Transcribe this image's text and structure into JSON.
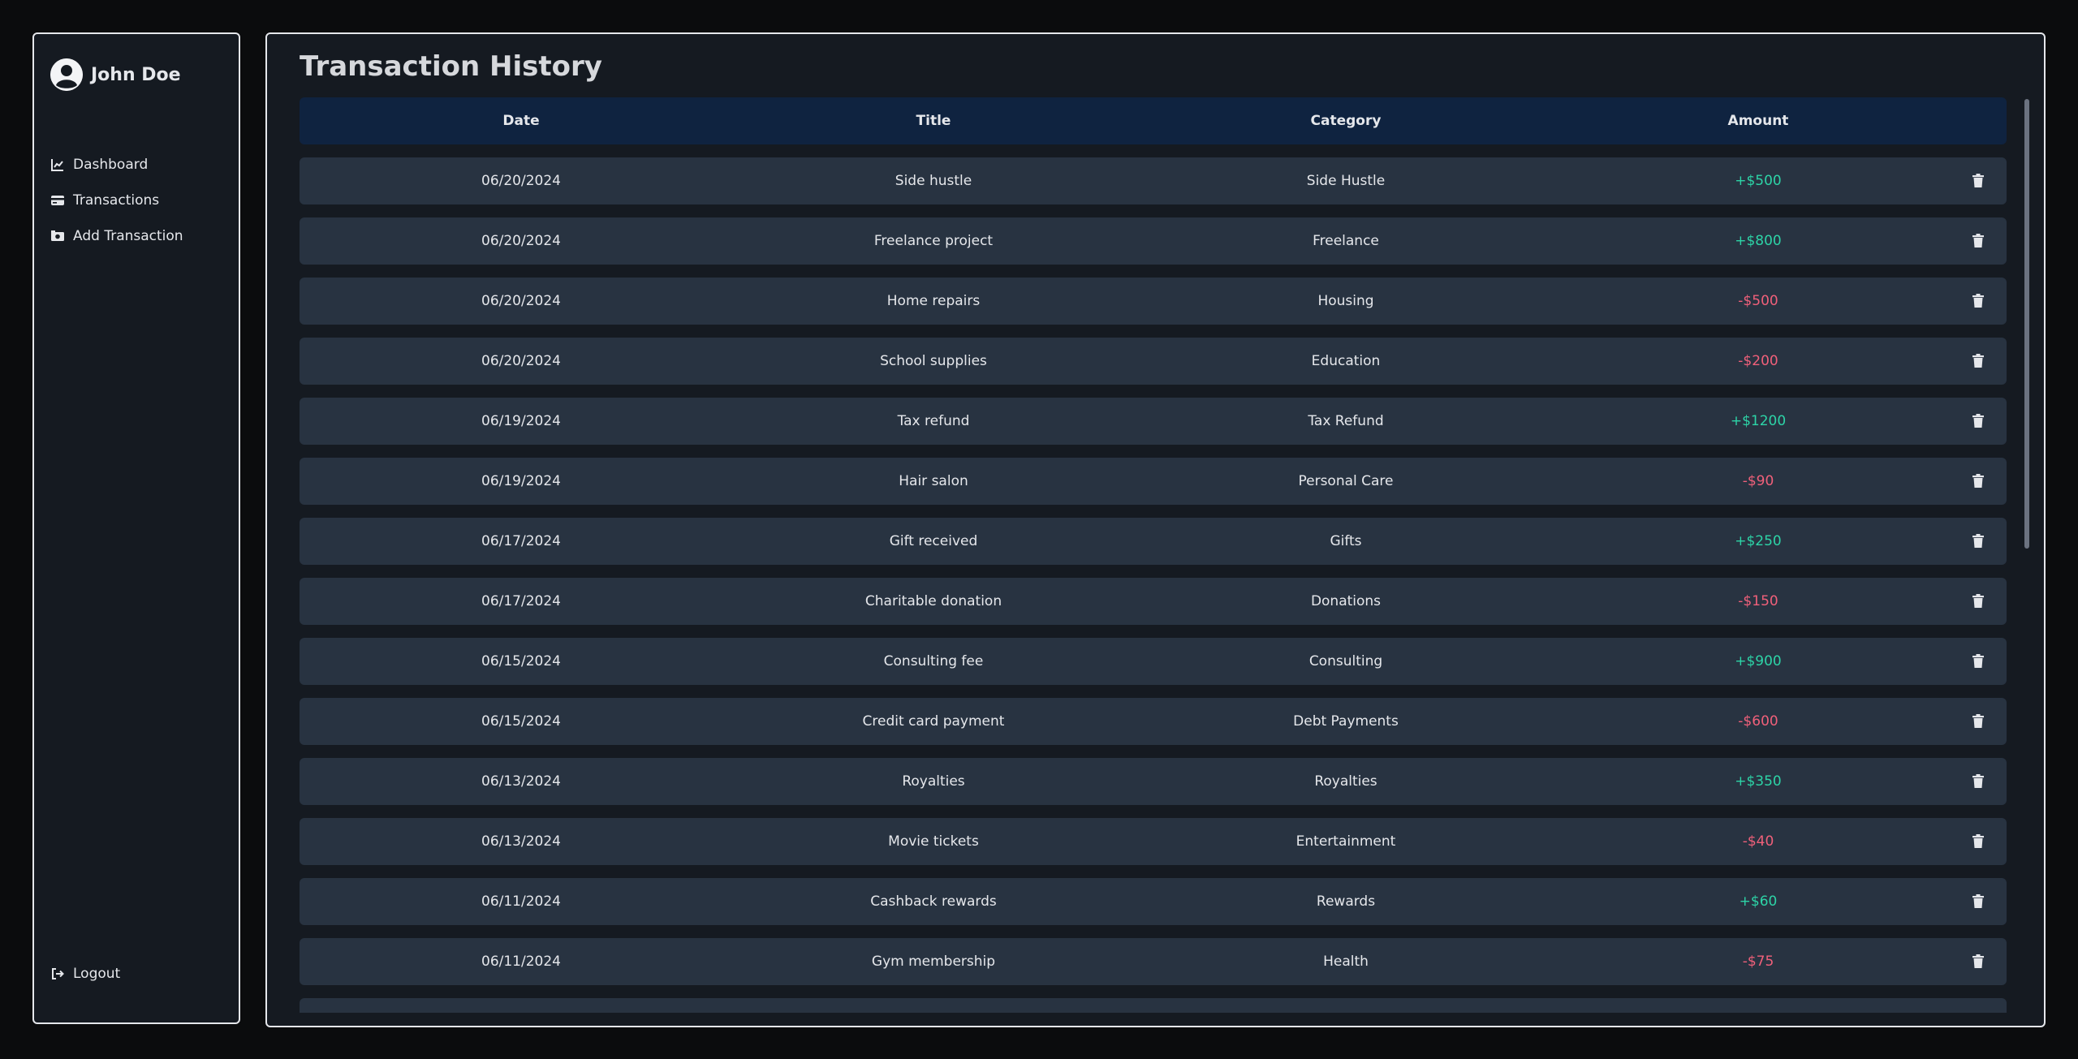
{
  "user": {
    "name": "John Doe"
  },
  "nav": {
    "items": [
      {
        "label": "Dashboard",
        "icon": "chart-line-icon"
      },
      {
        "label": "Transactions",
        "icon": "credit-card-icon"
      },
      {
        "label": "Add Transaction",
        "icon": "money-bill-icon"
      }
    ],
    "logout_label": "Logout"
  },
  "main": {
    "title": "Transaction History",
    "columns": [
      "Date",
      "Title",
      "Category",
      "Amount"
    ],
    "transactions": [
      {
        "date": "06/20/2024",
        "title": "Side hustle",
        "category": "Side Hustle",
        "amount": "+$500",
        "type": "income"
      },
      {
        "date": "06/20/2024",
        "title": "Freelance project",
        "category": "Freelance",
        "amount": "+$800",
        "type": "income"
      },
      {
        "date": "06/20/2024",
        "title": "Home repairs",
        "category": "Housing",
        "amount": "-$500",
        "type": "expense"
      },
      {
        "date": "06/20/2024",
        "title": "School supplies",
        "category": "Education",
        "amount": "-$200",
        "type": "expense"
      },
      {
        "date": "06/19/2024",
        "title": "Tax refund",
        "category": "Tax Refund",
        "amount": "+$1200",
        "type": "income"
      },
      {
        "date": "06/19/2024",
        "title": "Hair salon",
        "category": "Personal Care",
        "amount": "-$90",
        "type": "expense"
      },
      {
        "date": "06/17/2024",
        "title": "Gift received",
        "category": "Gifts",
        "amount": "+$250",
        "type": "income"
      },
      {
        "date": "06/17/2024",
        "title": "Charitable donation",
        "category": "Donations",
        "amount": "-$150",
        "type": "expense"
      },
      {
        "date": "06/15/2024",
        "title": "Consulting fee",
        "category": "Consulting",
        "amount": "+$900",
        "type": "income"
      },
      {
        "date": "06/15/2024",
        "title": "Credit card payment",
        "category": "Debt Payments",
        "amount": "-$600",
        "type": "expense"
      },
      {
        "date": "06/13/2024",
        "title": "Royalties",
        "category": "Royalties",
        "amount": "+$350",
        "type": "income"
      },
      {
        "date": "06/13/2024",
        "title": "Movie tickets",
        "category": "Entertainment",
        "amount": "-$40",
        "type": "expense"
      },
      {
        "date": "06/11/2024",
        "title": "Cashback rewards",
        "category": "Rewards",
        "amount": "+$60",
        "type": "income"
      },
      {
        "date": "06/11/2024",
        "title": "Gym membership",
        "category": "Health",
        "amount": "-$75",
        "type": "expense"
      },
      {
        "date": "",
        "title": "",
        "category": "",
        "amount": "",
        "type": "partial"
      }
    ]
  },
  "colors": {
    "income": "#2dd4a7",
    "expense": "#f0607a",
    "header_bg": "#0f2340",
    "row_bg": "#283341",
    "panel_bg": "#151a21",
    "page_bg": "#0b0c0d"
  }
}
